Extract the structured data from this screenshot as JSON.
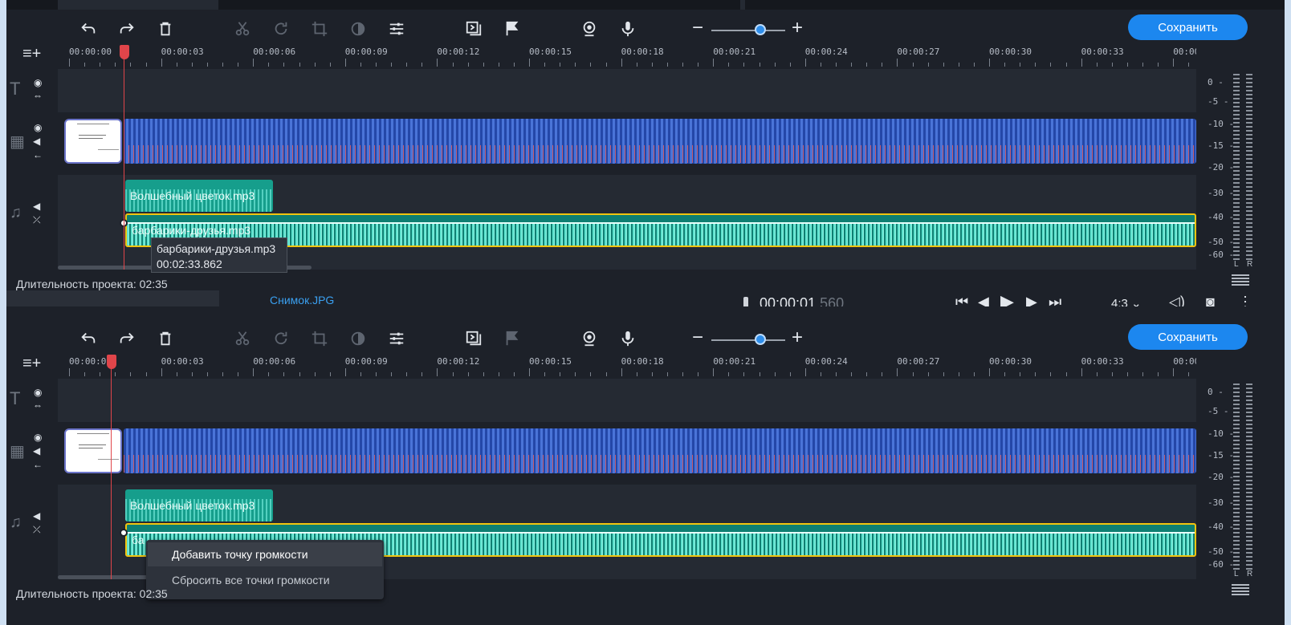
{
  "toolbar": {
    "save_label": "Сохранить",
    "icons": [
      "undo-icon",
      "redo-icon",
      "trash-icon",
      "cut-icon",
      "rotate-icon",
      "crop-icon",
      "color-adjust-icon",
      "equalizer-icon",
      "transitions-icon",
      "flag-icon",
      "webcam-icon",
      "microphone-icon",
      "zoom-out-icon",
      "zoom-in-icon"
    ],
    "zoom_level": 0.67
  },
  "ruler": {
    "labels": [
      "00:00:00",
      "00:00:03",
      "00:00:06",
      "00:00:09",
      "00:00:12",
      "00:00:15",
      "00:00:18",
      "00:00:21",
      "00:00:24",
      "00:00:27",
      "00:00:30",
      "00:00:33",
      "00:00:("
    ]
  },
  "top_panel": {
    "playhead_time": "00:00:01.560",
    "clips": {
      "music1": "Волшебный цветок.mp3",
      "music2": "барбарики-друзья.mp3"
    },
    "tooltip": {
      "name": "барбарики-друзья.mp3",
      "duration": "00:02:33.862"
    },
    "duration_label": "Длительность проекта: 02:35",
    "status": {
      "filename": "Снимок.JPG",
      "time_main": "00:00:01",
      "time_ms": ".560",
      "aspect": "4:3"
    }
  },
  "bottom_panel": {
    "clips": {
      "music1": "Волшебный цветок.mp3",
      "music2_partial": "ба"
    },
    "context_menu": [
      "Добавить точку громкости",
      "Сбросить все точки громкости"
    ],
    "duration_label": "Длительность проекта: 02:35"
  },
  "meter": {
    "labels": [
      "0",
      "-5",
      "-10",
      "-15",
      "-20",
      "-30",
      "-40",
      "-50",
      "-60"
    ],
    "channels": [
      "L",
      "R"
    ]
  }
}
